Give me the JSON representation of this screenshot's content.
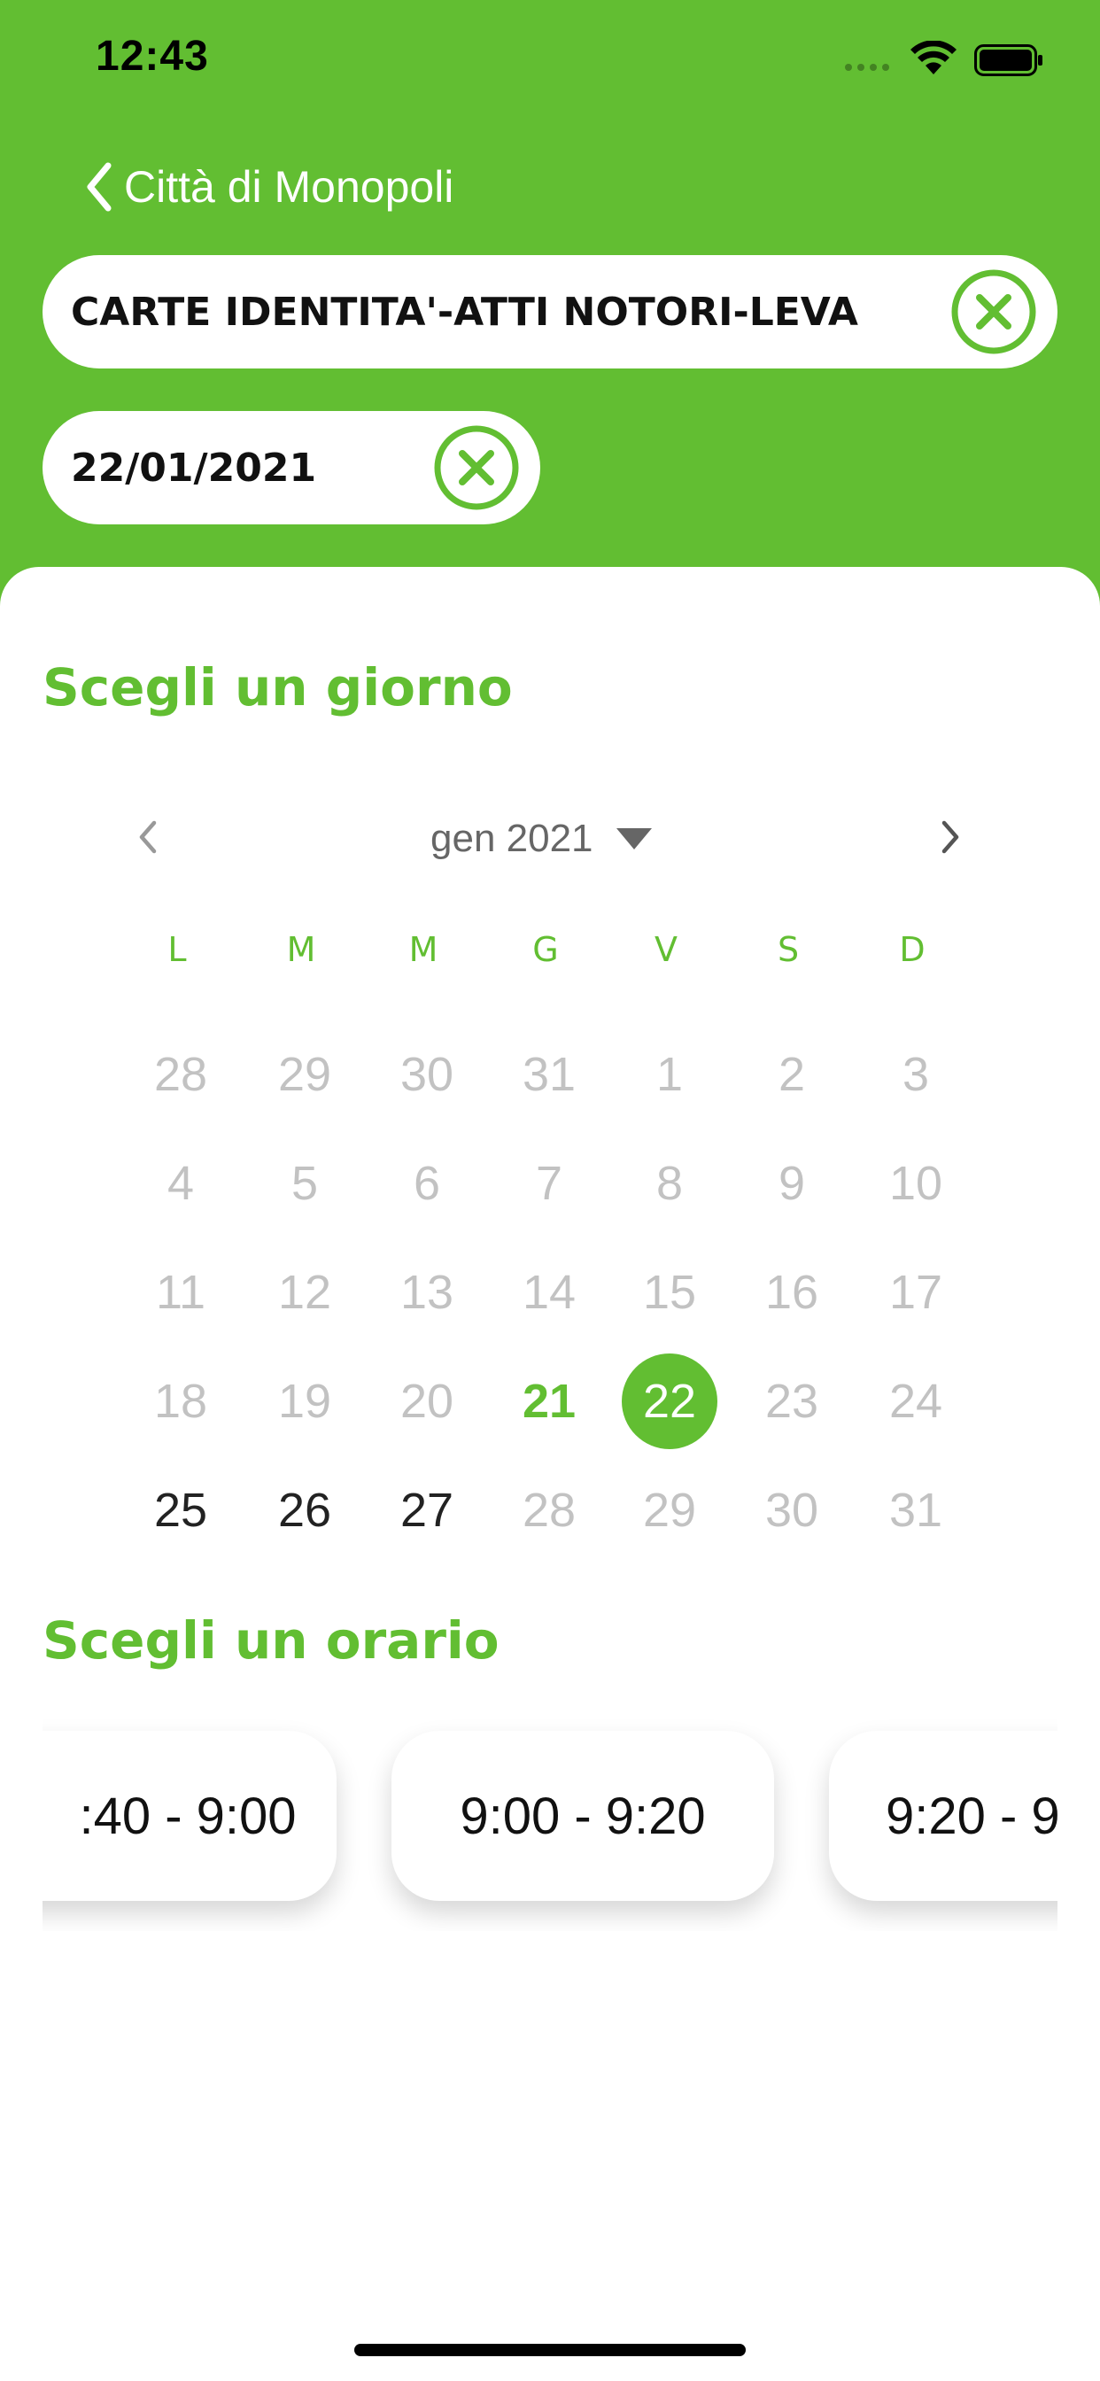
{
  "status_bar": {
    "time": "12:43"
  },
  "nav": {
    "back_label": "Città di Monopoli"
  },
  "filters": {
    "service": "CARTE IDENTITA'-ATTI NOTORI-LEVA",
    "date": "22/01/2021"
  },
  "calendar": {
    "title": "Scegli un giorno",
    "month_label": "gen 2021",
    "weekdays": [
      "L",
      "M",
      "M",
      "G",
      "V",
      "S",
      "D"
    ],
    "weeks": [
      [
        "28",
        "29",
        "30",
        "31",
        "1",
        "2",
        "3"
      ],
      [
        "4",
        "5",
        "6",
        "7",
        "8",
        "9",
        "10"
      ],
      [
        "11",
        "12",
        "13",
        "14",
        "15",
        "16",
        "17"
      ],
      [
        "18",
        "19",
        "20",
        "21",
        "22",
        "23",
        "24"
      ],
      [
        "25",
        "26",
        "27",
        "28",
        "29",
        "30",
        "31"
      ]
    ],
    "selected_day": "22",
    "today_day": "21"
  },
  "time_slots": {
    "title": "Scegli un orario",
    "slots": [
      ":40 - 9:00",
      "9:00 - 9:20",
      "9:20 - 9"
    ]
  },
  "colors": {
    "accent": "#62be32",
    "disabled_day": "#c2c2c2",
    "active_day": "#222222"
  }
}
